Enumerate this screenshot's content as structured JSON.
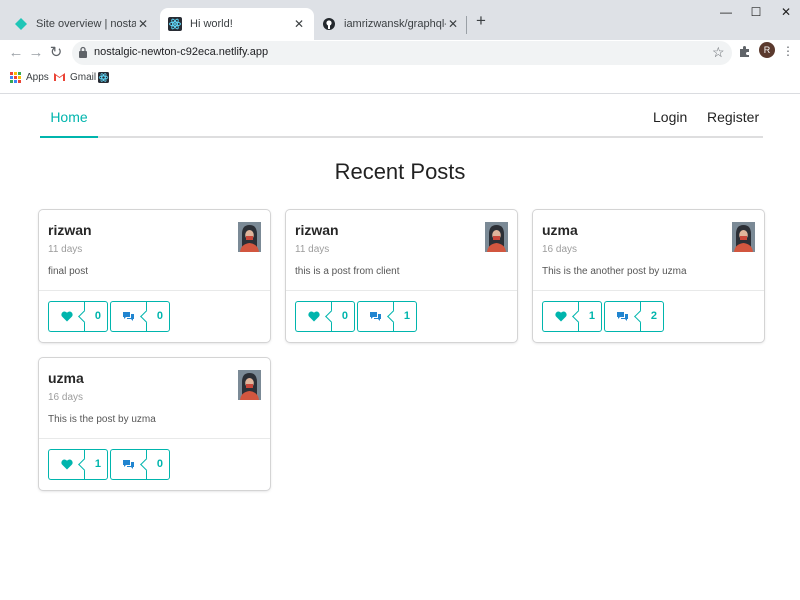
{
  "browser": {
    "tabs": [
      {
        "title": "Site overview | nostalgic-newton-c92eca",
        "icon": "netlify-icon",
        "active": false
      },
      {
        "title": "Hi world!",
        "icon": "react-icon",
        "active": true
      },
      {
        "title": "iamrizwansk/graphql-client",
        "icon": "github-icon",
        "active": false
      }
    ],
    "url": "nostalgic-newton-c92eca.netlify.app",
    "profile_initial": "R",
    "bookmarks": {
      "apps": "Apps",
      "gmail": "Gmail"
    }
  },
  "nav": {
    "home": "Home",
    "login": "Login",
    "register": "Register"
  },
  "headline": "Recent Posts",
  "colors": {
    "accent": "#00b5ad",
    "chrome": "#dee1e6"
  },
  "posts": [
    {
      "user": "rizwan",
      "age": "11 days",
      "body": "final post",
      "likes": "0",
      "comments": "0"
    },
    {
      "user": "rizwan",
      "age": "11 days",
      "body": "this is a post from client",
      "likes": "0",
      "comments": "1"
    },
    {
      "user": "uzma",
      "age": "16 days",
      "body": "This is the another post by uzma",
      "likes": "1",
      "comments": "2"
    },
    {
      "user": "uzma",
      "age": "16 days",
      "body": "This is the post by uzma",
      "likes": "1",
      "comments": "0"
    }
  ]
}
